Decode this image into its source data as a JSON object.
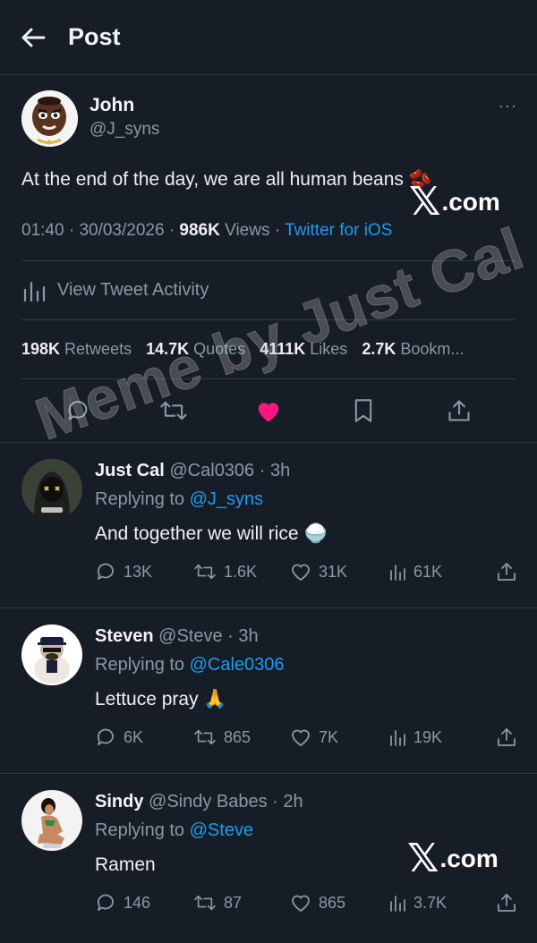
{
  "header": {
    "title": "Post"
  },
  "main_post": {
    "author_name": "John",
    "author_handle": "@J_syns",
    "text": "At the end of the day, we are all human beans 🫘",
    "time": "01:40",
    "date": "30/03/2026",
    "views_count": "986K",
    "views_label": "Views",
    "client": "Twitter for iOS",
    "activity_label": "View Tweet Activity",
    "stats": {
      "retweets_count": "198K",
      "retweets_label": "Retweets",
      "quotes_count": "14.7K",
      "quotes_label": "Quotes",
      "likes_count": "4111K",
      "likes_label": "Likes",
      "bookmarks_count": "2.7K",
      "bookmarks_label": "Bookm..."
    },
    "liked": true
  },
  "brand": {
    "x": "𝕏",
    "dotcom": ".com"
  },
  "watermark": "Meme by Just Cal",
  "replies": [
    {
      "name": "Just Cal",
      "handle": "@Cal0306",
      "time": "3h",
      "replying_prefix": "Replying to",
      "replying_to": "@J_syns",
      "text": "And together we will rice 🍚",
      "replies": "13K",
      "retweets": "1.6K",
      "likes": "31K",
      "views": "61K"
    },
    {
      "name": "Steven",
      "handle": "@Steve",
      "time": "3h",
      "replying_prefix": "Replying to",
      "replying_to": "@Cale0306",
      "text": "Lettuce pray 🙏",
      "replies": "6K",
      "retweets": "865",
      "likes": "7K",
      "views": "19K"
    },
    {
      "name": "Sindy",
      "handle": "@Sindy Babes",
      "time": "2h",
      "replying_prefix": "Replying to",
      "replying_to": "@Steve",
      "text": "Ramen",
      "replies": "146",
      "retweets": "87",
      "likes": "865",
      "views": "3.7K"
    }
  ],
  "colors": {
    "background": "#161d27",
    "link": "#1d9bf0",
    "like": "#f91880",
    "muted": "#8b98a5"
  }
}
